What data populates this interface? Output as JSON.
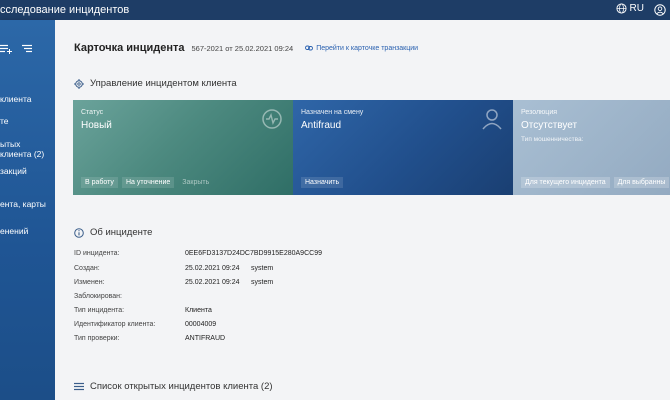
{
  "topbar": {
    "title": "сследование инцидентов",
    "lang": "RU"
  },
  "sidebar": {
    "items": [
      {
        "label": "клиента"
      },
      {
        "label": "те"
      },
      {
        "label": "ытых"
      },
      {
        "label": "клиента (2)"
      },
      {
        "label": "закций"
      },
      {
        "label": "ента, карты"
      },
      {
        "label": "енений"
      }
    ]
  },
  "header": {
    "title": "Карточка инцидента",
    "meta": "567-2021 от 25.02.2021 09:24",
    "link": "Перейти к карточке транзакции"
  },
  "management": {
    "title": "Управление инцидентом клиента"
  },
  "cards": {
    "status": {
      "label": "Статус",
      "value": "Новый",
      "actions": [
        "В работу",
        "На уточнение",
        "Закрыть"
      ]
    },
    "assigned": {
      "label": "Назначен на смену",
      "value": "Antifraud",
      "actions": [
        "Назначить"
      ]
    },
    "resolution": {
      "label": "Резолюция",
      "value": "Отсутствует",
      "sub": "Тип мошенничества:",
      "actions": [
        "Для текущего инцидента",
        "Для выбранны"
      ]
    }
  },
  "about": {
    "title": "Об инциденте",
    "rows": [
      {
        "key": "ID инцидента:",
        "value": "0EE6FD3137D24DC7BD9915E280A9CC99",
        "extra": ""
      },
      {
        "key": "Создан:",
        "value": "25.02.2021 09:24",
        "extra": "system"
      },
      {
        "key": "Изменен:",
        "value": "25.02.2021 09:24",
        "extra": "system"
      },
      {
        "key": "Заблокирован:",
        "value": "",
        "extra": ""
      },
      {
        "key": "Тип инцидента:",
        "value": "Клиента",
        "extra": ""
      },
      {
        "key": "Идентификатор клиента:",
        "value": "00004009",
        "extra": ""
      },
      {
        "key": "Тип проверки:",
        "value": "ANTIFRAUD",
        "extra": ""
      }
    ]
  },
  "open_list": {
    "title": "Список открытых инцидентов клиента (2)"
  }
}
